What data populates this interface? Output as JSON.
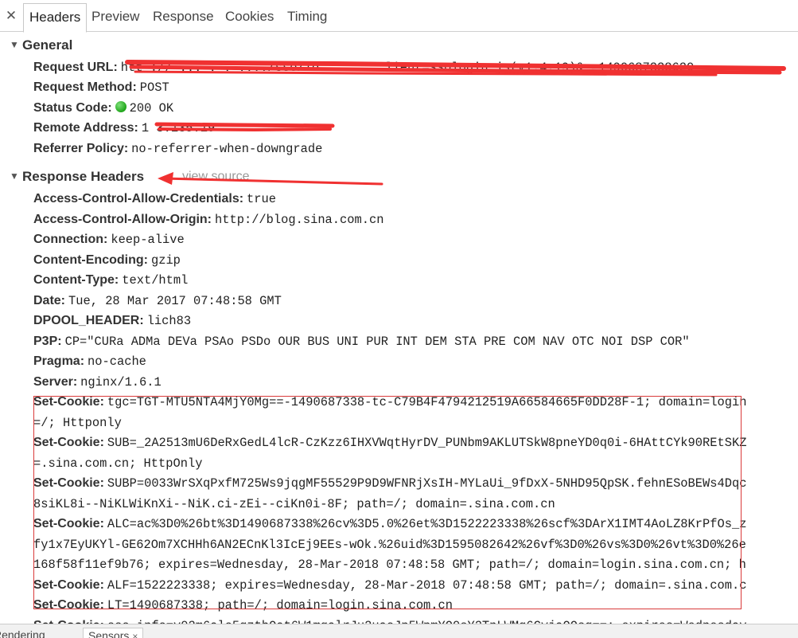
{
  "tabs": {
    "close_glyph": "✕",
    "items": [
      "Headers",
      "Preview",
      "Response",
      "Cookies",
      "Timing"
    ]
  },
  "general": {
    "title": "General",
    "request_url_key": "Request URL:",
    "request_url_value": "htt   ://     ...   .   .   ..../sso/lo    ...   .  ..lient=ssologin.js(v1.4.19)&_=1490687338620",
    "request_method_key": "Request Method:",
    "request_method_value": "POST",
    "status_code_key": "Status Code:",
    "status_code_value": "200 OK",
    "remote_address_key": "Remote Address:",
    "remote_address_value": "1 3.135.19",
    "referrer_policy_key": "Referrer Policy:",
    "referrer_policy_value": "no-referrer-when-downgrade"
  },
  "response_headers": {
    "title": "Response Headers",
    "view_source": "view source",
    "rows": [
      {
        "k": "Access-Control-Allow-Credentials:",
        "v": "true"
      },
      {
        "k": "Access-Control-Allow-Origin:",
        "v": "http://blog.sina.com.cn"
      },
      {
        "k": "Connection:",
        "v": "keep-alive"
      },
      {
        "k": "Content-Encoding:",
        "v": "gzip"
      },
      {
        "k": "Content-Type:",
        "v": "text/html"
      },
      {
        "k": "Date:",
        "v": "Tue, 28 Mar 2017 07:48:58 GMT"
      },
      {
        "k": "DPOOL_HEADER:",
        "v": "lich83"
      },
      {
        "k": "P3P:",
        "v": "CP=\"CURa ADMa DEVa PSAo PSDo OUR BUS UNI PUR INT DEM STA PRE COM NAV OTC NOI DSP COR\""
      },
      {
        "k": "Pragma:",
        "v": "no-cache"
      },
      {
        "k": "Server:",
        "v": "nginx/1.6.1"
      }
    ],
    "cookies": [
      {
        "k": "Set-Cookie:",
        "v": "tgc=TGT-MTU5NTA4MjY0Mg==-1490687338-tc-C79B4F4794212519A66584665F0DD28F-1; domain=login",
        "cont": [
          "=/; Httponly"
        ]
      },
      {
        "k": "Set-Cookie:",
        "v": "SUB=_2A2513mU6DeRxGedL4lcR-CzKzz6IHXVWqtHyrDV_PUNbm9AKLUTSkW8pneYD0q0i-6HAttCYk90REtSKZ",
        "cont": [
          "=.sina.com.cn; HttpOnly"
        ]
      },
      {
        "k": "Set-Cookie:",
        "v": "SUBP=0033WrSXqPxfM725Ws9jqgMF55529P9D9WFNRjXsIH-MYLaUi_9fDxX-5NHD95QpSK.fehnESoBEWs4Dqc",
        "cont": [
          "8siKL8i--NiKLWiKnXi--NiK.ci-zEi--ciKn0i-8F; path=/; domain=.sina.com.cn"
        ]
      },
      {
        "k": "Set-Cookie:",
        "v": "ALC=ac%3D0%26bt%3D1490687338%26cv%3D5.0%26et%3D1522223338%26scf%3DArX1IMT4AoLZ8KrPfOs_z",
        "cont": [
          "fy1x7EyUKYl-GE62Om7XCHHh6AN2ECnKl3IcEj9EEs-wOk.%26uid%3D1595082642%26vf%3D0%26vs%3D0%26vt%3D0%26e",
          "168f58f11ef9b76; expires=Wednesday, 28-Mar-2018 07:48:58 GMT; path=/; domain=login.sina.com.cn; h"
        ]
      },
      {
        "k": "Set-Cookie:",
        "v": "ALF=1522223338; expires=Wednesday, 28-Mar-2018 07:48:58 GMT; path=/; domain=.sina.com.c",
        "cont": []
      },
      {
        "k": "Set-Cookie:",
        "v": "LT=1490687338; path=/; domain=login.sina.com.cn",
        "cont": []
      },
      {
        "k": "Set-Cookie:",
        "v": "sso_info=v02m6alo5qztbOat6W1mqalrJu2uaoJp5WpmYO0sY2TnLWMg6CyjaOOsg==; expires=Wednesday",
        "cont": []
      }
    ]
  },
  "drawer": {
    "tabs": [
      "Rendering",
      "Sensors"
    ],
    "close_glyph": "×"
  },
  "colors": {
    "redact_stroke": "#f03131",
    "annotation_box": "#d93a3a",
    "status_ok": "#1fa51a"
  }
}
